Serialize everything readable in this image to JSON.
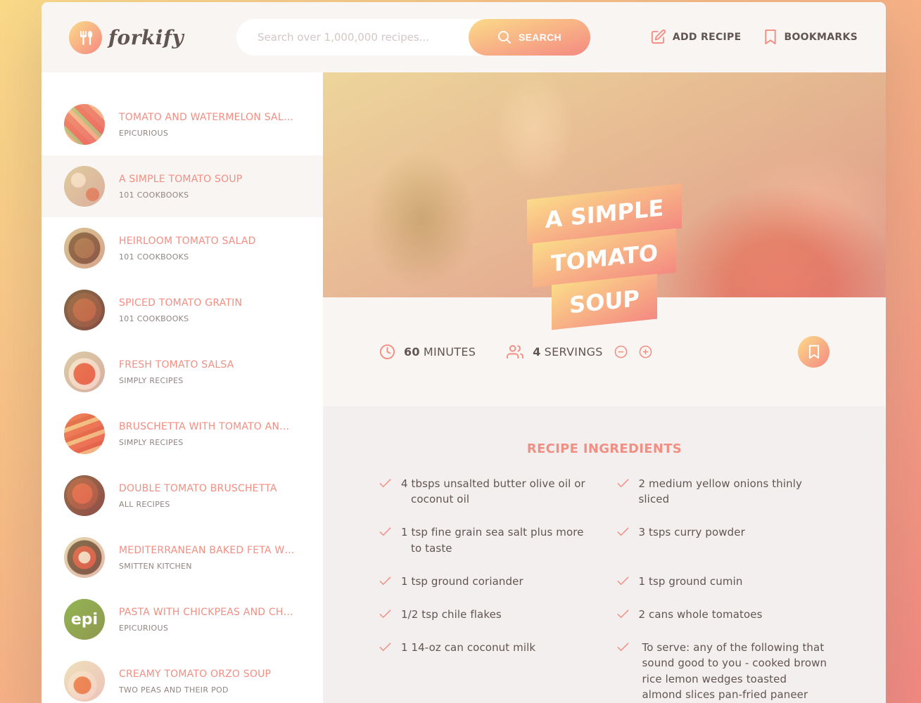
{
  "app": {
    "logo_text": "forkify",
    "colors": {
      "grad_start": "#fbdb89",
      "grad_end": "#f48982",
      "accent": "#f38e82",
      "text": "#615551",
      "muted": "#918581"
    }
  },
  "header": {
    "search_placeholder": "Search over 1,000,000 recipes...",
    "search_label": "SEARCH",
    "add_recipe_label": "ADD RECIPE",
    "bookmarks_label": "BOOKMARKS"
  },
  "results": [
    {
      "title": "TOMATO AND WATERMELON SALAD",
      "publisher": "EPICURIOUS"
    },
    {
      "title": "A SIMPLE TOMATO SOUP",
      "publisher": "101 COOKBOOKS"
    },
    {
      "title": "HEIRLOOM TOMATO SALAD",
      "publisher": "101 COOKBOOKS"
    },
    {
      "title": "SPICED TOMATO GRATIN",
      "publisher": "101 COOKBOOKS"
    },
    {
      "title": "FRESH TOMATO SALSA",
      "publisher": "SIMPLY RECIPES"
    },
    {
      "title": "BRUSCHETTA WITH TOMATO AND BASIL",
      "publisher": "SIMPLY RECIPES"
    },
    {
      "title": "DOUBLE TOMATO BRUSCHETTA",
      "publisher": "ALL RECIPES"
    },
    {
      "title": "MEDITERRANEAN BAKED FETA WITH TOMATOES",
      "publisher": "SMITTEN KITCHEN"
    },
    {
      "title": "PASTA WITH CHICKPEAS AND CHARD",
      "publisher": "EPICURIOUS"
    },
    {
      "title": "CREAMY TOMATO ORZO SOUP",
      "publisher": "TWO PEAS AND THEIR POD"
    }
  ],
  "recipe": {
    "title_line1": "A SIMPLE TOMATO",
    "title_line2": "SOUP",
    "minutes": "60",
    "minutes_label": "MINUTES",
    "servings": "4",
    "servings_label": "SERVINGS",
    "ingredients_heading": "RECIPE INGREDIENTS",
    "ingredients": [
      "4 tbsps unsalted butter olive oil or coconut oil",
      "2 medium yellow onions thinly sliced",
      "1 tsp fine grain sea salt plus more to taste",
      "3 tsps curry powder",
      "1 tsp ground coriander",
      "1 tsp ground cumin",
      "1/2 tsp chile flakes",
      "2 cans whole tomatoes",
      "1 14-oz can coconut milk",
      "To serve: any of the following that sound good to you - cooked brown rice lemon wedges toasted almond slices pan-fried paneer fresh thyme"
    ]
  }
}
